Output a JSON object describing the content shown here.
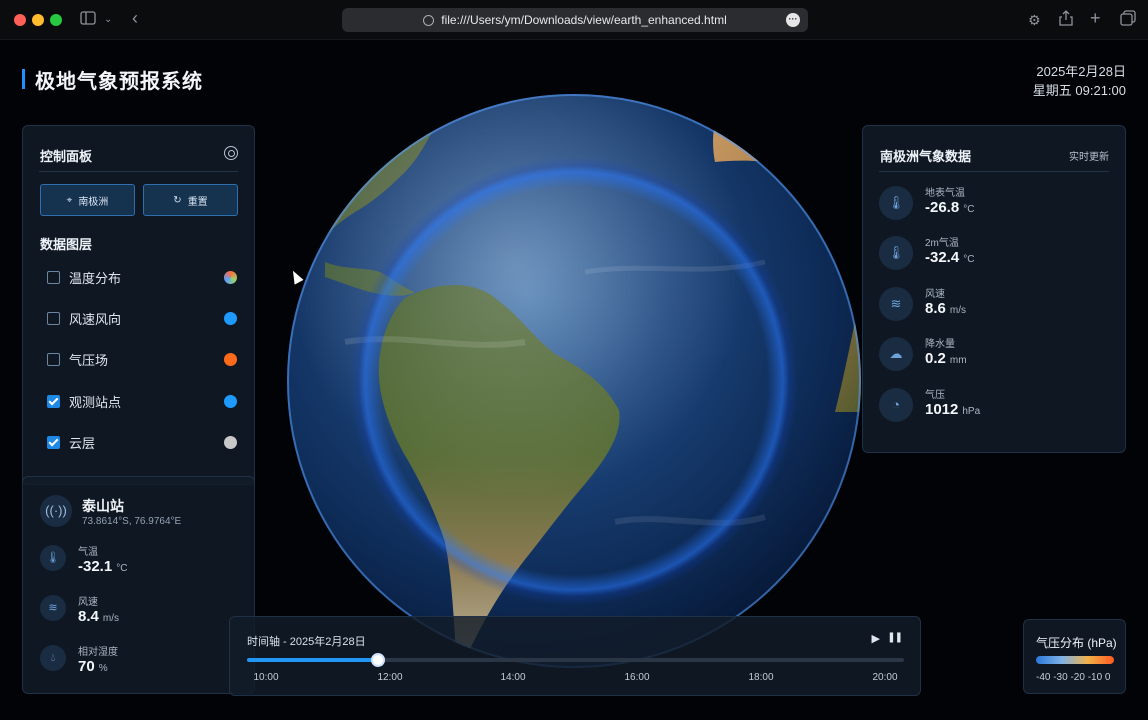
{
  "browser": {
    "url": "file:///Users/ym/Downloads/view/earth_enhanced.html"
  },
  "header": {
    "title": "极地气象预报系统",
    "date": "2025年2月28日",
    "weekday_time": "星期五 09:21:00"
  },
  "control_panel": {
    "title": "控制面板",
    "buttons": [
      {
        "label": "南极洲",
        "icon": "location-pin-icon"
      },
      {
        "label": "重置",
        "icon": "refresh-icon"
      }
    ],
    "layers_title": "数据图层",
    "layers": [
      {
        "label": "温度分布",
        "checked": false,
        "color": "#9a8a8a"
      },
      {
        "label": "风速风向",
        "checked": false,
        "color": "#1e9bff"
      },
      {
        "label": "气压场",
        "checked": false,
        "color": "#ff6a1a"
      },
      {
        "label": "观测站点",
        "checked": true,
        "color": "#1e9bff"
      },
      {
        "label": "云层",
        "checked": true,
        "color": "#c8c8c8"
      }
    ]
  },
  "station": {
    "name": "泰山站",
    "coords": "73.8614°S, 76.9764°E",
    "metrics": [
      {
        "label": "气温",
        "value": "-32.1",
        "unit": "°C",
        "icon": "thermometer-icon"
      },
      {
        "label": "风速",
        "value": "8.4",
        "unit": "m/s",
        "icon": "wind-icon"
      },
      {
        "label": "相对湿度",
        "value": "70",
        "unit": "%",
        "icon": "humidity-icon"
      }
    ]
  },
  "antarctica": {
    "title": "南极洲气象数据",
    "status": "实时更新",
    "metrics": [
      {
        "label": "地表气温",
        "value": "-26.8",
        "unit": "°C",
        "icon": "thermometer-icon"
      },
      {
        "label": "2m气温",
        "value": "-32.4",
        "unit": "°C",
        "icon": "thermometer-icon"
      },
      {
        "label": "风速",
        "value": "8.6",
        "unit": "m/s",
        "icon": "wind-icon"
      },
      {
        "label": "降水量",
        "value": "0.2",
        "unit": "mm",
        "icon": "rain-cloud-icon"
      },
      {
        "label": "气压",
        "value": "1012",
        "unit": "hPa",
        "icon": "gauge-icon"
      }
    ]
  },
  "timeline": {
    "title": "时间轴 - 2025年2月28日",
    "ticks": [
      "10:00",
      "12:00",
      "14:00",
      "16:00",
      "18:00",
      "20:00"
    ],
    "progress": 0.2
  },
  "legend": {
    "title": "气压分布 (hPa)",
    "ticks": "-40 -30 -20 -10 0"
  }
}
